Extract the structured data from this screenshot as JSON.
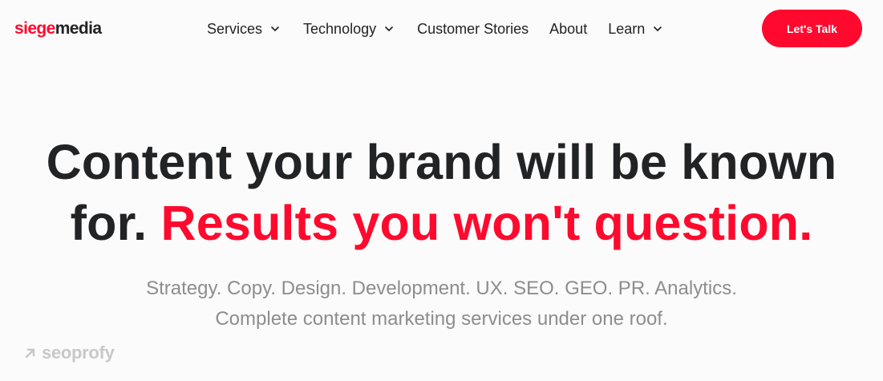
{
  "brand": {
    "logo_part1": "siege",
    "logo_part2": "media",
    "accent_color": "#ff0a2e",
    "text_color": "#222325"
  },
  "nav": {
    "items": [
      {
        "label": "Services",
        "icon": "chevron-down-icon"
      },
      {
        "label": "Technology",
        "icon": "chevron-down-icon"
      },
      {
        "label": "Customer Stories"
      },
      {
        "label": "About"
      },
      {
        "label": "Learn",
        "icon": "chevron-down-icon"
      }
    ]
  },
  "cta": {
    "label": "Let's Talk"
  },
  "hero": {
    "headline_line1": "Content your brand will be known",
    "headline_line2_prefix": "for.",
    "headline_line2_accent": "Results you won't question.",
    "sub_line1": "Strategy. Copy. Design. Development. UX. SEO. GEO. PR. Analytics.",
    "sub_line2": "Complete content marketing services under one roof."
  },
  "watermark": {
    "text": "seoprofy",
    "icon": "arrow-up-right-icon"
  }
}
